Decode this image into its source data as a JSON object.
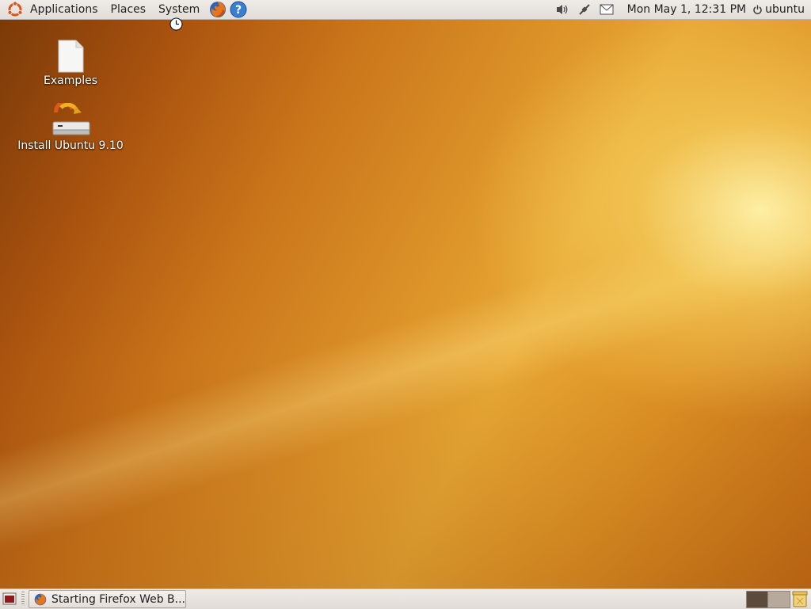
{
  "top_panel": {
    "menus": [
      "Applications",
      "Places",
      "System"
    ],
    "clock": "Mon May  1, 12:31 PM",
    "user": "ubuntu",
    "icons": [
      "ubuntu-logo-icon",
      "firefox-icon",
      "help-icon",
      "volume-icon",
      "network-icon",
      "mail-icon",
      "power-icon"
    ]
  },
  "desktop": {
    "icons": [
      {
        "label": "Examples",
        "icon": "document-icon"
      },
      {
        "label": "Install Ubuntu 9.10",
        "icon": "installer-icon"
      }
    ]
  },
  "bottom_panel": {
    "task": "Starting Firefox Web B...",
    "workspaces": 2
  },
  "colors": {
    "accent": "#dd8a24",
    "panel": "#e6e1dc"
  }
}
